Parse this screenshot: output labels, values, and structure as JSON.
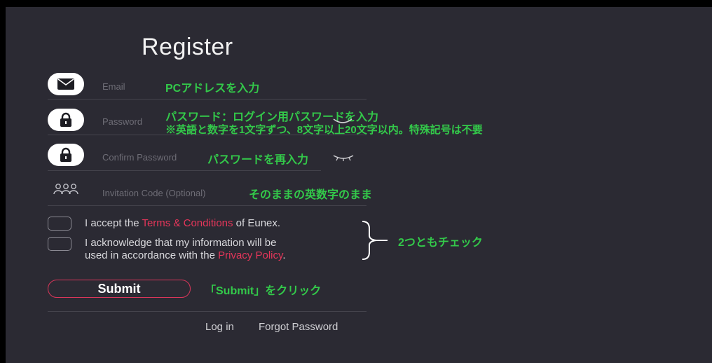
{
  "form": {
    "title": "Register",
    "email_placeholder": "Email",
    "password_placeholder": "Password",
    "confirm_placeholder": "Confirm Password",
    "invite_placeholder": "Invitation Code (Optional)",
    "terms_prefix": "I accept the ",
    "terms_link": "Terms & Conditions",
    "terms_suffix": " of Eunex.",
    "privacy_line1": "I acknowledge that my information will be",
    "privacy_line2_prefix": "used in accordance with the ",
    "privacy_link": "Privacy Policy",
    "privacy_suffix": ".",
    "submit_label": "Submit",
    "login_link": "Log in",
    "forgot_link": "Forgot Password"
  },
  "annotations": {
    "email_note": "PCアドレスを入力",
    "password_note_1": "パスワード：ログイン用パスワードを入力",
    "password_note_2": "※英語と数字を1文字ずつ、8文字以上20文字以内。特殊記号は不要",
    "confirm_note": "パスワードを再入力",
    "invite_note": "そのままの英数字のまま",
    "check_note": "2つともチェック",
    "submit_note": "「Submit」をクリック"
  },
  "colors": {
    "background": "#2b2a33",
    "accent": "#e5365a",
    "annotation": "#33c94a"
  },
  "icons": {
    "email": "envelope-icon",
    "password": "lock-icon",
    "confirm": "lock-icon",
    "invite": "users-icon",
    "eye": "eye-closed-icon"
  }
}
